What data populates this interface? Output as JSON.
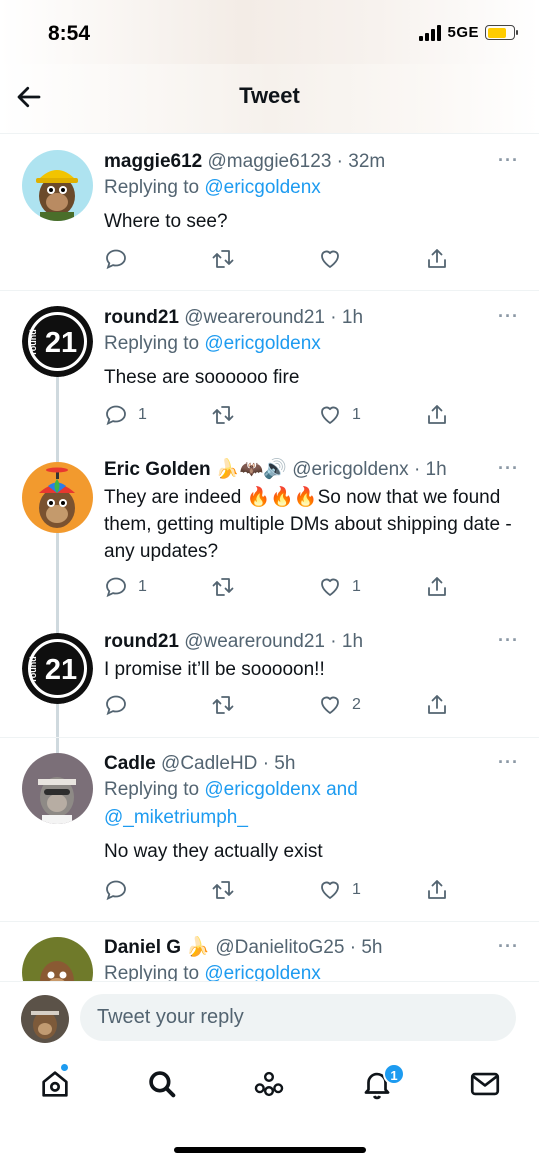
{
  "status_bar": {
    "time": "8:54",
    "network": "5GE",
    "battery_color": "#ffcc00"
  },
  "header": {
    "title": "Tweet",
    "back_icon": "arrow-left-icon"
  },
  "tweets": [
    {
      "name": "maggie612",
      "handle": "@maggie6123",
      "time": "32m",
      "reply_prefix": "Replying to",
      "reply_to": "@ericgoldenx",
      "text": "Where to see?",
      "reply_count": "",
      "retweet_count": "",
      "like_count": "",
      "avatar": "ape-yellow-hat-avatar"
    },
    {
      "name": "round21",
      "handle": "@weareround21",
      "time": "1h",
      "reply_prefix": "Replying to",
      "reply_to": "@ericgoldenx",
      "text": "These are soooooo fire",
      "reply_count": "1",
      "retweet_count": "",
      "like_count": "1",
      "avatar": "round21-logo-avatar",
      "avatar_text": "21",
      "avatar_subtext": "round"
    },
    {
      "name": "Eric Golden",
      "name_emojis": "🍌🦇🔊",
      "handle": "@ericgoldenx",
      "time": "1h",
      "text_a": "They are indeed ",
      "fire": "🔥🔥🔥",
      "text_b": "So now that we found them, getting multiple DMs about shipping date - any updates?",
      "reply_count": "1",
      "retweet_count": "",
      "like_count": "1",
      "avatar": "ape-propeller-hat-avatar"
    },
    {
      "name": "round21",
      "handle": "@weareround21",
      "time": "1h",
      "text": "I promise it’ll be sooooon!!",
      "reply_count": "",
      "retweet_count": "",
      "like_count": "2",
      "avatar": "round21-logo-avatar",
      "avatar_text": "21",
      "avatar_subtext": "round"
    },
    {
      "name": "Cadle",
      "handle": "@CadleHD",
      "time": "5h",
      "reply_prefix": "Replying to",
      "reply_to": "@ericgoldenx and",
      "reply_to_2": "@_miketriumph_",
      "text": "No way they actually exist",
      "reply_count": "",
      "retweet_count": "",
      "like_count": "1",
      "avatar": "ape-grey-avatar"
    },
    {
      "name": "Daniel G",
      "name_emojis": "🍌",
      "handle": "@DanielitoG25",
      "time": "5h",
      "reply_prefix": "Replying to",
      "reply_to": "@ericgoldenx",
      "avatar": "ape-green-avatar"
    }
  ],
  "more_label": "···",
  "dot_sep": "·",
  "reply_bar": {
    "placeholder": "Tweet your reply"
  },
  "tabbar": {
    "items": [
      "home-icon",
      "search-icon",
      "spaces-icon",
      "notifications-icon",
      "messages-icon"
    ],
    "notifications_badge": "1"
  },
  "colors": {
    "accent": "#1d9bf0",
    "secondary_text": "#536471"
  }
}
